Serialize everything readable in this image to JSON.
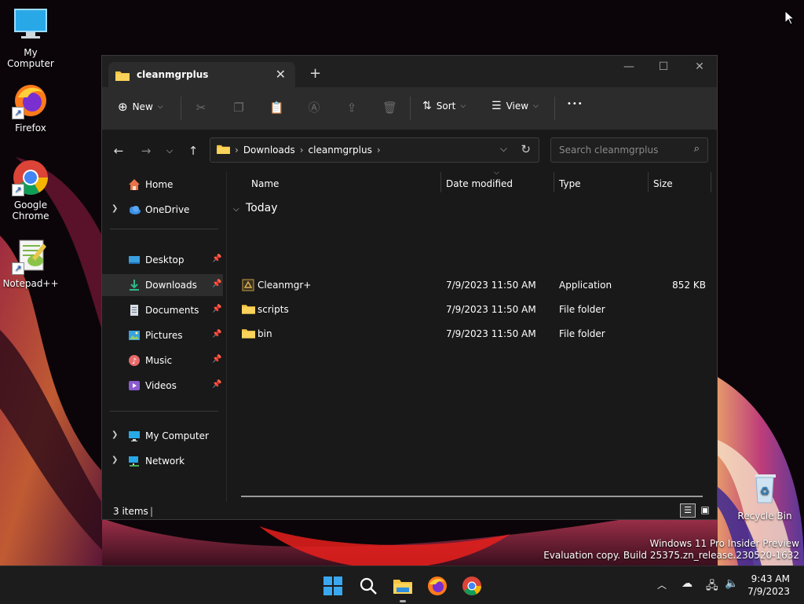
{
  "desktop": {
    "icons": [
      {
        "label": "My Computer"
      },
      {
        "label": "Firefox"
      },
      {
        "label": "Google Chrome"
      },
      {
        "label": "Notepad++"
      },
      {
        "label": "Recycle Bin"
      }
    ],
    "watermark_line1": "Windows 11 Pro Insider Preview",
    "watermark_line2": "Evaluation copy. Build 25375.zn_release.230520-1632"
  },
  "window": {
    "tab_title": "cleanmgrplus",
    "tab_close": "✕",
    "new_tab": "+",
    "controls": {
      "minimize": "—",
      "maximize": "☐",
      "close": "✕"
    },
    "toolbar": {
      "new_label": "New",
      "sort_label": "Sort",
      "view_label": "View",
      "more_label": "•••"
    },
    "address": {
      "crumbs": [
        "Downloads",
        "cleanmgrplus"
      ],
      "search_placeholder": "Search cleanmgrplus"
    },
    "nav_pane": {
      "home": "Home",
      "onedrive": "OneDrive",
      "quick": [
        {
          "label": "Desktop"
        },
        {
          "label": "Downloads"
        },
        {
          "label": "Documents"
        },
        {
          "label": "Pictures"
        },
        {
          "label": "Music"
        },
        {
          "label": "Videos"
        }
      ],
      "my_computer": "My Computer",
      "network": "Network"
    },
    "columns": {
      "name": "Name",
      "date": "Date modified",
      "type": "Type",
      "size": "Size"
    },
    "group_label": "Today",
    "files": [
      {
        "name": "Cleanmgr+",
        "date": "7/9/2023 11:50 AM",
        "type": "Application",
        "size": "852 KB"
      },
      {
        "name": "scripts",
        "date": "7/9/2023 11:50 AM",
        "type": "File folder",
        "size": ""
      },
      {
        "name": "bin",
        "date": "7/9/2023 11:50 AM",
        "type": "File folder",
        "size": ""
      }
    ],
    "status": {
      "item_count": "3 items"
    }
  },
  "taskbar": {
    "time": "9:43 AM",
    "date": "7/9/2023"
  },
  "colors": {
    "window_bg": "#191919",
    "toolbar_bg": "#2c2c2c",
    "folder_yellow": "#f4c542",
    "taskbar_bg": "#1c1c1c"
  }
}
